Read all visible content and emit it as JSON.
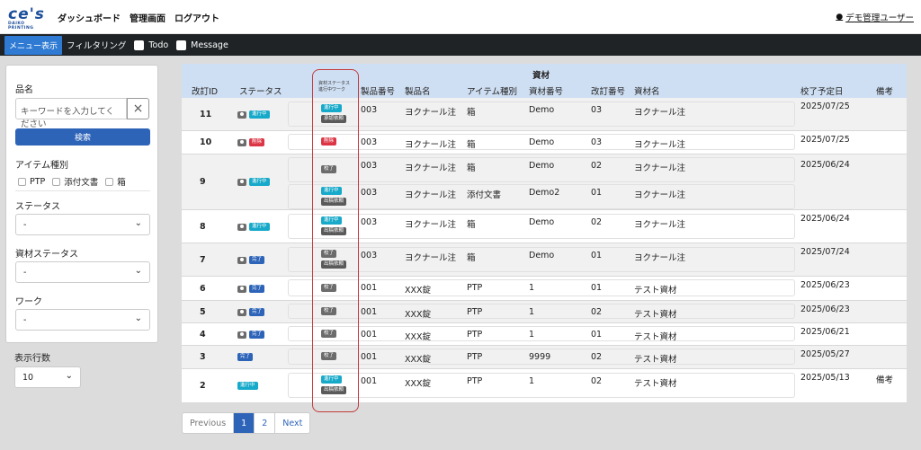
{
  "nav": {
    "logo_mark": "ce's",
    "logo_sub": "DAIKO PRINTING",
    "links": [
      "ダッシュボード",
      "管理画面",
      "ログアウト"
    ],
    "user": "デモ管理ユーザー"
  },
  "subbar": {
    "menu_button": "メニュー表示",
    "filter_label": "フィルタリング",
    "todo_label": "Todo",
    "message_label": "Message"
  },
  "sidebar": {
    "name_label": "品名",
    "keyword_placeholder": "キーワードを入力してください",
    "clear_icon": "×",
    "search_button": "検索",
    "item_type_label": "アイテム種別",
    "item_types": [
      "PTP",
      "添付文書",
      "箱"
    ],
    "status_label": "ステータス",
    "status_value": "-",
    "material_status_label": "資材ステータス",
    "material_status_value": "-",
    "work_label": "ワーク",
    "work_value": "-",
    "rows_label": "表示行数",
    "rows_value": "10"
  },
  "table": {
    "headers": {
      "rev_id": "改訂ID",
      "status": "ステータス",
      "mat_status_line1": "資材ステータス",
      "mat_status_line2": "進行中ワーク",
      "product_no": "製品番号",
      "product_name": "製品名",
      "item_type": "アイテム種別",
      "material_group": "資材",
      "material_no": "資材番号",
      "rev_no": "改訂番号",
      "material_name": "資材名",
      "proof_date": "校了予定日",
      "remarks": "備考"
    },
    "rows": [
      {
        "id": "11",
        "status": "進行中",
        "subs": [
          {
            "mat_status": "進行中",
            "work": "承認依頼",
            "product_no": "003",
            "product_name": "ヨクナール注",
            "item_type": "箱",
            "material_no": "Demo",
            "rev_no": "03",
            "material_name": "ヨクナール注"
          }
        ],
        "proof_date": "2025/07/25",
        "remarks": ""
      },
      {
        "id": "10",
        "status": "削除",
        "subs": [
          {
            "mat_status": "削除",
            "work": "",
            "product_no": "003",
            "product_name": "ヨクナール注",
            "item_type": "箱",
            "material_no": "Demo",
            "rev_no": "03",
            "material_name": "ヨクナール注"
          }
        ],
        "proof_date": "2025/07/25",
        "remarks": ""
      },
      {
        "id": "9",
        "status": "進行中",
        "subs": [
          {
            "mat_status": "校了",
            "work": "",
            "product_no": "003",
            "product_name": "ヨクナール注",
            "item_type": "箱",
            "material_no": "Demo",
            "rev_no": "02",
            "material_name": "ヨクナール注"
          },
          {
            "mat_status": "進行中",
            "work": "出稿依頼",
            "product_no": "003",
            "product_name": "ヨクナール注",
            "item_type": "添付文書",
            "material_no": "Demo2",
            "rev_no": "01",
            "material_name": "ヨクナール注"
          }
        ],
        "proof_date": "2025/06/24",
        "remarks": ""
      },
      {
        "id": "8",
        "status": "進行中",
        "subs": [
          {
            "mat_status": "進行中",
            "work": "出稿依頼",
            "product_no": "003",
            "product_name": "ヨクナール注",
            "item_type": "箱",
            "material_no": "Demo",
            "rev_no": "02",
            "material_name": "ヨクナール注"
          }
        ],
        "proof_date": "2025/06/24",
        "remarks": ""
      },
      {
        "id": "7",
        "status": "完了",
        "subs": [
          {
            "mat_status": "校了",
            "work": "出稿依頼",
            "product_no": "003",
            "product_name": "ヨクナール注",
            "item_type": "箱",
            "material_no": "Demo",
            "rev_no": "01",
            "material_name": "ヨクナール注"
          }
        ],
        "proof_date": "2025/07/24",
        "remarks": ""
      },
      {
        "id": "6",
        "status": "完了",
        "subs": [
          {
            "mat_status": "校了",
            "work": "",
            "product_no": "001",
            "product_name": "XXX錠",
            "item_type": "PTP",
            "material_no": "1",
            "rev_no": "01",
            "material_name": "テスト資材"
          }
        ],
        "proof_date": "2025/06/23",
        "remarks": ""
      },
      {
        "id": "5",
        "status": "完了",
        "subs": [
          {
            "mat_status": "校了",
            "work": "",
            "product_no": "001",
            "product_name": "XXX錠",
            "item_type": "PTP",
            "material_no": "1",
            "rev_no": "02",
            "material_name": "テスト資材"
          }
        ],
        "proof_date": "2025/06/23",
        "remarks": ""
      },
      {
        "id": "4",
        "status": "完了",
        "subs": [
          {
            "mat_status": "校了",
            "work": "",
            "product_no": "001",
            "product_name": "XXX錠",
            "item_type": "PTP",
            "material_no": "1",
            "rev_no": "01",
            "material_name": "テスト資材"
          }
        ],
        "proof_date": "2025/06/21",
        "remarks": ""
      },
      {
        "id": "3",
        "status": "完了",
        "subs": [
          {
            "mat_status": "校了",
            "work": "",
            "product_no": "001",
            "product_name": "XXX錠",
            "item_type": "PTP",
            "material_no": "9999",
            "rev_no": "02",
            "material_name": "テスト資材"
          }
        ],
        "proof_date": "2025/05/27",
        "remarks": ""
      },
      {
        "id": "2",
        "status": "進行中",
        "subs": [
          {
            "mat_status": "進行中",
            "work": "出稿依頼",
            "product_no": "001",
            "product_name": "XXX錠",
            "item_type": "PTP",
            "material_no": "1",
            "rev_no": "02",
            "material_name": "テスト資材"
          }
        ],
        "proof_date": "2025/05/13",
        "remarks": "備考"
      }
    ]
  },
  "pager": {
    "previous": "Previous",
    "pages": [
      "1",
      "2"
    ],
    "next": "Next"
  },
  "colors": {
    "primary": "#2d64b8",
    "progress": "#17a9c9",
    "deleted": "#dc3545",
    "done": "#2d64b8",
    "proofed": "#6c6c6c",
    "highlight": "#c23b3b"
  }
}
